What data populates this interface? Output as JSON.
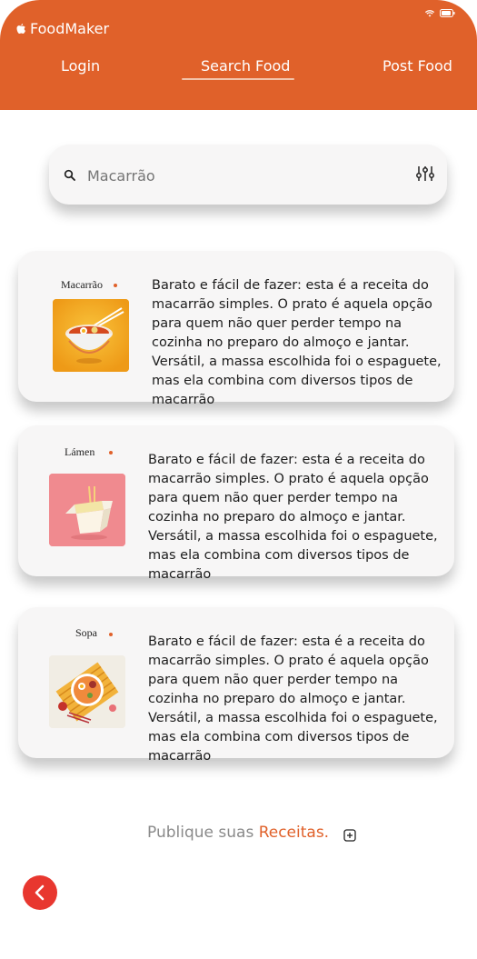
{
  "header": {
    "app_title": "FoodMaker",
    "tabs": [
      {
        "label": "Login"
      },
      {
        "label": "Search Food"
      },
      {
        "label": "Post Food"
      }
    ],
    "active_tab": "Search Food",
    "accent_color": "#e0612a"
  },
  "search": {
    "value": "",
    "placeholder": "Macarrão"
  },
  "cards": [
    {
      "title": "Macarrão",
      "image_icon": "ramen-bowl-icon",
      "description": "Barato e fácil de fazer: esta é a receita do macarrão simples. O prato é aquela opção para quem não quer perder tempo na cozinha no preparo do almoço e jantar. Versátil, a massa escolhida foi o espaguete, mas ela combina com diversos tipos de macarrão"
    },
    {
      "title": "Lámen",
      "image_icon": "noodle-box-icon",
      "description": "Barato e fácil de fazer: esta é a receita do macarrão simples. O prato é aquela opção para quem não quer perder tempo na cozinha no preparo do almoço e jantar. Versátil, a massa escolhida foi o espaguete, mas ela combina com diversos tipos de macarrão"
    },
    {
      "title": "Sopa",
      "image_icon": "soup-bowl-icon",
      "description": "Barato e fácil de fazer: esta é a receita do macarrão simples. O prato é aquela opção para quem não quer perder tempo na cozinha no preparo do almoço e jantar. Versátil, a massa escolhida foi o espaguete, mas ela combina com diversos tipos de macarrão"
    }
  ],
  "footer": {
    "text": "Publique suas ",
    "highlight": "Receitas."
  }
}
